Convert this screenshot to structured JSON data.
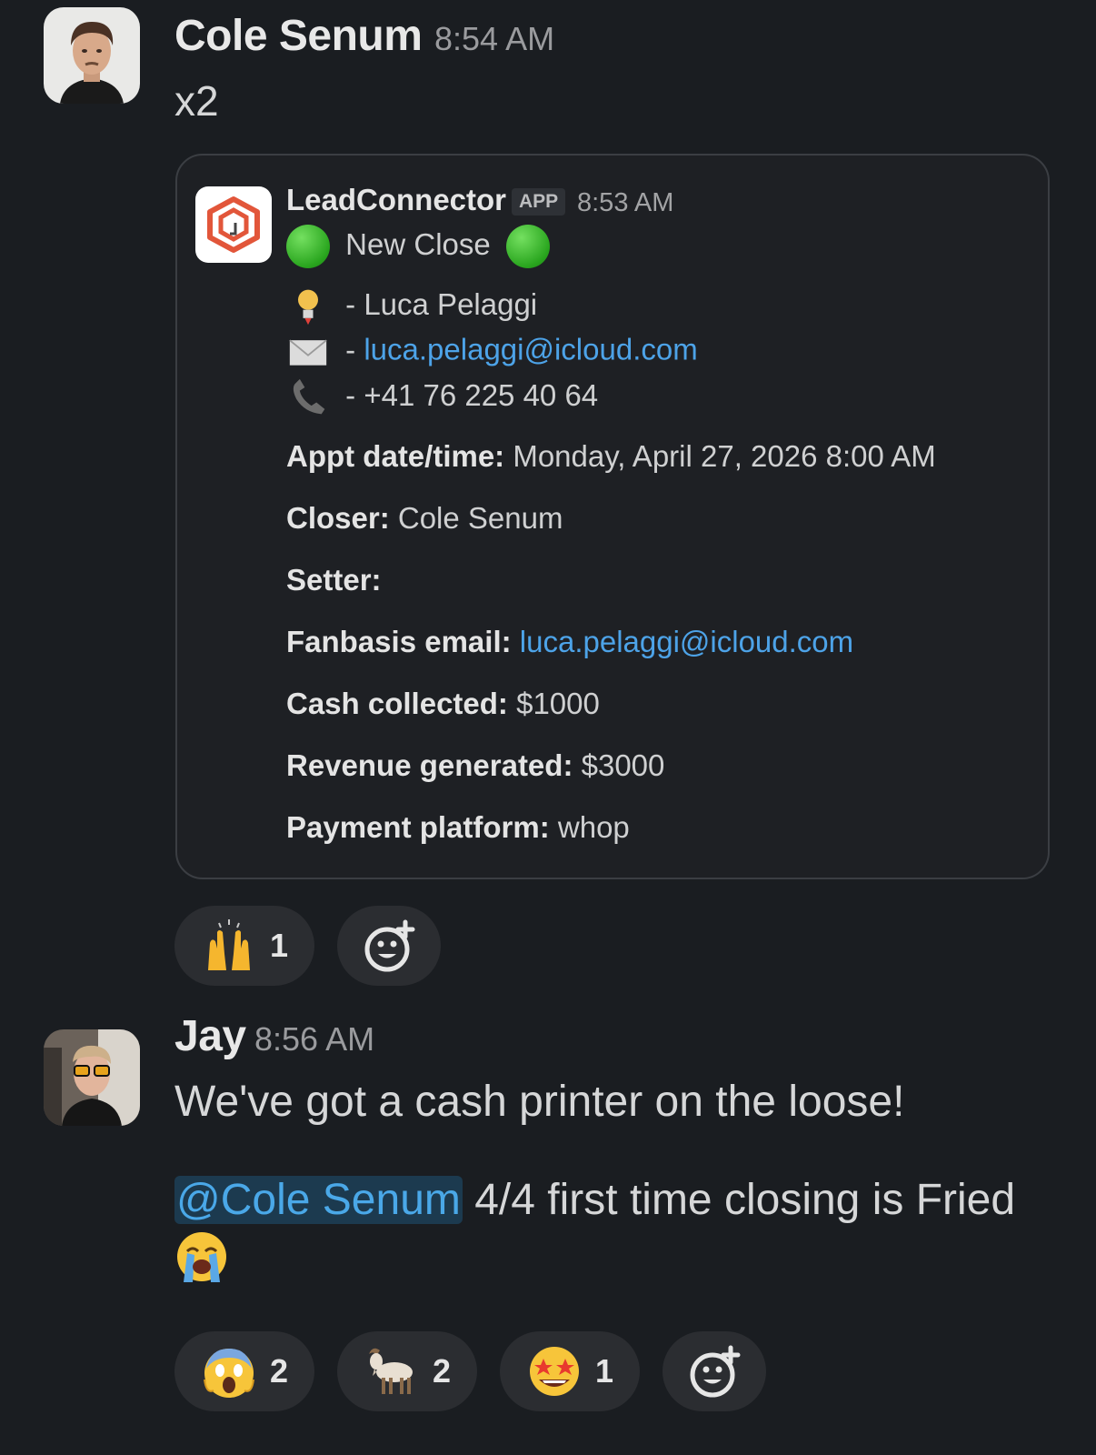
{
  "messages": [
    {
      "author": "Cole Senum",
      "time": "8:54 AM",
      "text": "x2",
      "attachment": {
        "app_name": "LeadConnector",
        "badge": "APP",
        "time": "8:53 AM",
        "headline": "New Close",
        "contact_name": "- Luca Pelaggi",
        "contact_email_prefix": "-",
        "contact_email": "luca.pelaggi@icloud.com",
        "contact_phone": "- +41 76 225 40 64",
        "fields": [
          {
            "label": "Appt date/time:",
            "value": "Monday, April 27, 2026 8:00 AM"
          },
          {
            "label": "Closer:",
            "value": "Cole Senum"
          },
          {
            "label": "Setter:",
            "value": ""
          },
          {
            "label": "Fanbasis email:",
            "value": "luca.pelaggi@icloud.com"
          },
          {
            "label": "Cash collected:",
            "value": "$1000"
          },
          {
            "label": "Revenue generated:",
            "value": "$3000"
          },
          {
            "label": "Payment platform:",
            "value": "whop"
          }
        ]
      },
      "reactions": [
        {
          "emoji": "raised-hands",
          "count": "1"
        }
      ]
    },
    {
      "author": "Jay",
      "time": "8:56 AM",
      "line1": "We've got a cash printer on the loose!",
      "mention": "@Cole Senum",
      "line2": "4/4 first time closing is Fried",
      "reactions": [
        {
          "emoji": "screaming-face",
          "count": "2"
        },
        {
          "emoji": "goat",
          "count": "2"
        },
        {
          "emoji": "star-struck",
          "count": "1"
        }
      ]
    }
  ],
  "colors": {
    "background": "#1a1d21",
    "link": "#4da3e8",
    "mention_bg": "#1c3a4f",
    "reaction_bg": "#2b2d31"
  }
}
